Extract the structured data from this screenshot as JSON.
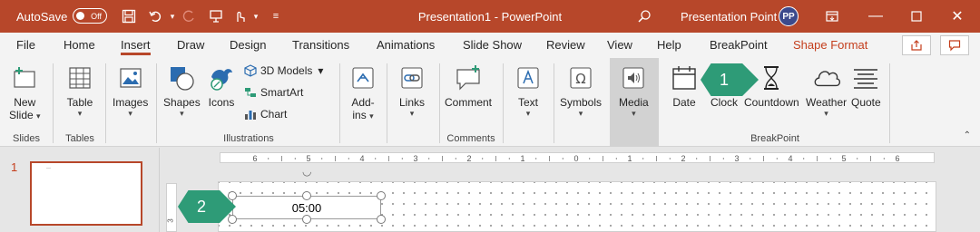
{
  "titlebar": {
    "autosave_label": "AutoSave",
    "autosave_state": "Off",
    "document_title": "Presentation1  -  PowerPoint",
    "user_name": "Presentation Point",
    "avatar_initials": "PP",
    "bg_color": "#b7472a"
  },
  "tabs": [
    "File",
    "Home",
    "Insert",
    "Draw",
    "Design",
    "Transitions",
    "Animations",
    "Slide Show",
    "Review",
    "View",
    "Help",
    "BreakPoint",
    "Shape Format"
  ],
  "ribbon": {
    "slides": {
      "group": "Slides",
      "new_slide": "New",
      "new_slide_2": "Slide"
    },
    "tables": {
      "group": "Tables",
      "table": "Table"
    },
    "images": {
      "label": "Images"
    },
    "illustrations": {
      "group": "Illustrations",
      "shapes": "Shapes",
      "icons": "Icons",
      "models": "3D Models",
      "smartart": "SmartArt",
      "chart": "Chart"
    },
    "addins": {
      "label1": "Add-",
      "label2": "ins"
    },
    "links": {
      "label": "Links"
    },
    "comments": {
      "group": "Comments",
      "comment": "Comment"
    },
    "text": {
      "label": "Text"
    },
    "symbols": {
      "label": "Symbols"
    },
    "media": {
      "label": "Media"
    },
    "breakpoint": {
      "group": "BreakPoint",
      "date": "Date",
      "clock": "Clock",
      "countdown": "Countdown",
      "weather": "Weather",
      "quote": "Quote"
    }
  },
  "callouts": {
    "one": "1",
    "two": "2",
    "color": "#2e9b77"
  },
  "ruler": {
    "ticks": [
      "6",
      "5",
      "4",
      "3",
      "2",
      "1",
      "0",
      "1",
      "2",
      "3",
      "4",
      "5",
      "6"
    ],
    "v_tick": "3"
  },
  "slides_pane": {
    "slide_number": "1"
  },
  "slide": {
    "countdown_text": "05:00"
  }
}
